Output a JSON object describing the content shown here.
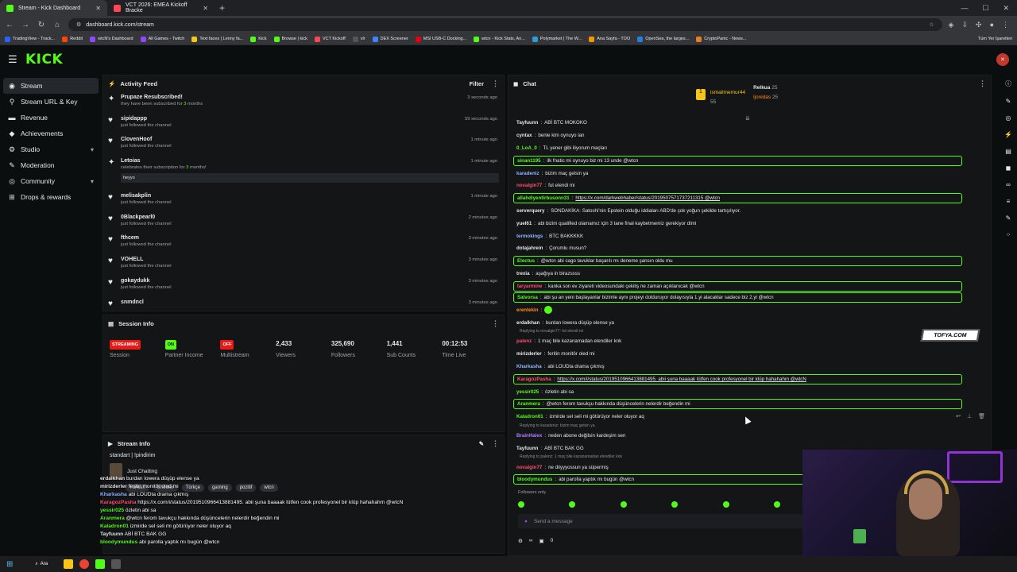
{
  "browser": {
    "tabs": [
      {
        "label": "Stream - Kick Dashboard",
        "color": "#53fc18",
        "active": true
      },
      {
        "label": "VCT 2026: EMEA Kickoff Bracke",
        "color": "#ff4655",
        "active": false
      }
    ],
    "url": "dashboard.kick.com/stream",
    "bookmarks": [
      "TradingView - Track...",
      "Reddit",
      "wtcN's Dashboard",
      "All Games - Twitch",
      "Text faces | Lenny fa...",
      "Kick",
      "Browse | kick",
      "VCT Kickoff",
      "vlr",
      "DEX Screener",
      "MSI USB-C Docking...",
      "wtcn - Kick Stats, An...",
      "Polymarket | The W...",
      "Ana Sayfa - TOO",
      "OpenSea, the larges...",
      "CryptoPanic - News..."
    ],
    "bookmarks_right": "Tüm Yer İşaretleri"
  },
  "brand": {
    "logo": "KICK",
    "accent": "#53fc18"
  },
  "sidebar": {
    "items": [
      {
        "label": "Stream",
        "icon": "broadcast-icon",
        "glyph": "◉"
      },
      {
        "label": "Stream URL & Key",
        "icon": "key-icon",
        "glyph": "⚲"
      },
      {
        "label": "Revenue",
        "icon": "cash-icon",
        "glyph": "▬"
      },
      {
        "label": "Achievements",
        "icon": "trophy-icon",
        "glyph": "◆"
      },
      {
        "label": "Studio",
        "icon": "studio-icon",
        "glyph": "⚙"
      },
      {
        "label": "Moderation",
        "icon": "wrench-icon",
        "glyph": "✎"
      },
      {
        "label": "Community",
        "icon": "community-icon",
        "glyph": "◎"
      },
      {
        "label": "Drops & rewards",
        "icon": "gift-icon",
        "glyph": "⊞"
      }
    ]
  },
  "activity": {
    "title": "Activity Feed",
    "filter": "Filter",
    "items": [
      {
        "name": "Prupaze Resubscribed!",
        "sub": "they have been subscribed for ",
        "sub_strong": "3",
        "sub_after": " months",
        "time": "3 seconds ago",
        "icon": "star-icon",
        "glyph": "✦"
      },
      {
        "name": "sipidappp",
        "sub": "just followed the channel",
        "sub_strong": "",
        "sub_after": "",
        "time": "59 seconds ago",
        "icon": "heart-icon",
        "glyph": "♥"
      },
      {
        "name": "ClovenHoof",
        "sub": "just followed the channel",
        "sub_strong": "",
        "sub_after": "",
        "time": "1 minute ago",
        "icon": "heart-icon",
        "glyph": "♥"
      },
      {
        "name": "Letoias",
        "sub": "celebrates their subscription for ",
        "sub_strong": "3",
        "sub_after": " months!",
        "time": "1 minute ago",
        "icon": "star-icon",
        "glyph": "✦",
        "message": "heyyo"
      },
      {
        "name": "melisakplin",
        "sub": "just followed the channel",
        "sub_strong": "",
        "sub_after": "",
        "time": "1 minute ago",
        "icon": "heart-icon",
        "glyph": "♥"
      },
      {
        "name": "0Blackpearl0",
        "sub": "just followed the channel",
        "sub_strong": "",
        "sub_after": "",
        "time": "2 minutes ago",
        "icon": "heart-icon",
        "glyph": "♥"
      },
      {
        "name": "fthcem",
        "sub": "just followed the channel",
        "sub_strong": "",
        "sub_after": "",
        "time": "3 minutes ago",
        "icon": "heart-icon",
        "glyph": "♥"
      },
      {
        "name": "VOHELL",
        "sub": "just followed the channel",
        "sub_strong": "",
        "sub_after": "",
        "time": "3 minutes ago",
        "icon": "heart-icon",
        "glyph": "♥"
      },
      {
        "name": "gokaydukk",
        "sub": "just followed the channel",
        "sub_strong": "",
        "sub_after": "",
        "time": "3 minutes ago",
        "icon": "heart-icon",
        "glyph": "♥"
      },
      {
        "name": "snmdncl",
        "sub": "",
        "sub_strong": "",
        "sub_after": "",
        "time": "3 minutes ago",
        "icon": "heart-icon",
        "glyph": "♥"
      }
    ]
  },
  "session": {
    "title": "Session Info",
    "stats": [
      {
        "badge": "STREAMING",
        "badge_color": "red",
        "label": "Session"
      },
      {
        "badge": "ON",
        "badge_color": "green",
        "label": "Partner Income"
      },
      {
        "badge": "OFF",
        "badge_color": "red",
        "label": "Multistream"
      },
      {
        "value": "2,433",
        "label": "Viewers"
      },
      {
        "value": "325,690",
        "label": "Followers"
      },
      {
        "value": "1,441",
        "label": "Sub Counts"
      },
      {
        "value": "00:12:53",
        "label": "Time Live"
      }
    ]
  },
  "stream_info": {
    "title": "Stream Info",
    "stream_title": "standart | !pindirim",
    "category": "Just Chatting",
    "tags": [
      "Türkish",
      "Shooter",
      "Türkçe",
      "gaming",
      "pozitif",
      "wtcn"
    ]
  },
  "overlay_chat": [
    {
      "user": "erdalkhan",
      "text": "burdan lowera düşüp elense ya",
      "color": "#e6e7e8"
    },
    {
      "user": "mirizderler",
      "text": "feritin monitör oled mi",
      "color": "#e6e7e8"
    },
    {
      "user": "Kharkasha",
      "text": "abi LOUDta drama çıkmış",
      "color": "#8fb4ff"
    },
    {
      "user": "KaragozPasha",
      "text": "https://x.com/i/status/2019510966413881495. abii şuna baaaak lütfen cook profesyonel bir klüp hahahahm @wtcN",
      "color": "#ff4d6d"
    },
    {
      "user": "yessir025",
      "text": "özletin abi sa",
      "color": "#53fc18"
    },
    {
      "user": "Aranmera",
      "text": "@wtcn ferom tavukçu hakkında düşüncelerin nelerdir beğendin mi",
      "color": "#53fc18"
    },
    {
      "user": "Kaladron01",
      "text": "izmirde sel seli mi götürüyor neler oluyor aq",
      "color": "#53fc18"
    },
    {
      "user": "Tayfuunn",
      "text": "ABİ BTC BAK GG",
      "color": "#e6e7e8"
    },
    {
      "user": "bloodymundus",
      "text": "abi parolla yaptık mı bugün @wtcn",
      "color": "#53fc18"
    }
  ],
  "chat": {
    "title": "Chat",
    "pinned_left": [
      {
        "name": "ismailmemur44",
        "value": "55"
      }
    ],
    "pinned_right": [
      {
        "name": "Relkua",
        "value": "25"
      },
      {
        "name": "ljonidas",
        "value": "25"
      }
    ],
    "messages": [
      {
        "user": "Tayfuunn",
        "text": "ABİ BTC MOKOKO",
        "color": "#e6e7e8",
        "hl": false
      },
      {
        "user": "cyntax",
        "text": "benle kim oynuyo lan",
        "color": "#e6e7e8",
        "hl": false
      },
      {
        "user": "0_LoA_0",
        "text": "TL yener gibi iliyorum maçları",
        "color": "#53fc18",
        "hl": false
      },
      {
        "user": "sinan1195",
        "text": "ilk fnatic mi oynuyo biz mi 13 unde @wtcn",
        "color": "#53fc18",
        "hl": true
      },
      {
        "user": "karadeniz",
        "text": "bizim maç gelsin ya",
        "color": "#8fb4ff",
        "hl": false
      },
      {
        "user": "novalgin77",
        "text": "fut elendi mi",
        "color": "#ff4d6d",
        "hl": false
      },
      {
        "user": "allahdiyentirbusonn31",
        "text": "https://x.com/darkwebhaber/status/2019507571737211315 @wtcn",
        "color": "#53fc18",
        "hl": true
      },
      {
        "user": "serverquery",
        "text": "SONDAKİKA: Satoshi'nin Epstein olduğu iddiaları ABD'de çok yoğun şekilde tartışılıyor.",
        "color": "#e6e7e8",
        "hl": false
      },
      {
        "user": "yuel61",
        "text": "abi bizim qualified olamamız için 3 tane final kaybetmemiz gerekiyor dimi",
        "color": "#e6e7e8",
        "hl": false
      },
      {
        "user": "termokings",
        "text": "BTC BAKKKKK",
        "color": "#8fb4ff",
        "hl": false
      },
      {
        "user": "dotajahrein",
        "text": "Çorumlu musun?",
        "color": "#e6e7e8",
        "hl": false
      },
      {
        "user": "Electus",
        "text": "@wtcn abi cago tavuklar başarılı mı deneme şansın oldu mu",
        "color": "#53fc18",
        "hl": true
      },
      {
        "user": "trexia",
        "text": "aşağıya in birazssss",
        "color": "#e6e7e8",
        "hl": false
      },
      {
        "user": "laryarmine",
        "text": "kanka son ev ziyareti videosundaki çekiliş ne zaman açıklanıcak @wtcn",
        "color": "#ff4d6d",
        "hl": true
      },
      {
        "user": "Salvorsa",
        "text": "abi şu an yeni başlayanlar bizimle aynı projeyi dolduruyor dolayısıyla 1.yi alacaklar sadece biz 2.yi @wtcn",
        "color": "#53fc18",
        "hl": true
      },
      {
        "user": "erentekin",
        "text": "",
        "color": "#ff8c1a",
        "hl": false
      },
      {
        "user": "erdalkhan",
        "text": "burdan lowera düşüp elense ya",
        "color": "#e6e7e8",
        "hl": false
      },
      {
        "user": "palenz",
        "text": "1 maç bile kazanamadan elendiler knk",
        "color": "#ff4d6d",
        "hl": false,
        "reply": "Replying to novalgin77: fut elendi mi"
      },
      {
        "user": "mirizderler",
        "text": "feritin monitör oled mi",
        "color": "#e6e7e8",
        "hl": false
      },
      {
        "user": "Kharkasha",
        "text": "abi LOUDta drama çıkmış",
        "color": "#8fb4ff",
        "hl": false
      },
      {
        "user": "KaragozPasha",
        "text": "https://x.com/i/status/2019510966413881495. abii şuna baaaak lütfen cook profesyonel bir klüp hahahahm @wtcN",
        "color": "#ff4d6d",
        "hl": true
      },
      {
        "user": "yessir025",
        "text": "özletin abi sa",
        "color": "#53fc18",
        "hl": false
      },
      {
        "user": "Aranmera",
        "text": "@wtcn ferom tavukçu hakkında düşüncelerin nelerdir beğendin mi",
        "color": "#53fc18",
        "hl": true
      },
      {
        "user": "Kaladron01",
        "text": "izmirde sel seli mi götürüyor neler oluyor aq",
        "color": "#53fc18",
        "hl": false
      },
      {
        "user": "BrainHalex",
        "text": "neden abone değilsin kardeşim sen",
        "color": "#b07cff",
        "hl": false,
        "reply": "Replying to karadeniz: bizim maç gelsin ya"
      },
      {
        "user": "Tayfuunn",
        "text": "ABİ BTC BAK GG",
        "color": "#e6e7e8",
        "hl": false
      },
      {
        "user": "novalgin77",
        "text": "ne diiyyyossun ya süpermiş",
        "color": "#ff4d6d",
        "hl": false,
        "reply": "Replying to palenz: 1 maç bile kazanamadan elendiler knk"
      },
      {
        "user": "bloodymundus",
        "text": "abi parolla yaptık mı bugün @wtcn",
        "color": "#53fc18",
        "hl": true
      }
    ],
    "followers_only": "Followers only",
    "input_placeholder": "Send a message",
    "bottom_count": "0"
  },
  "watermark": "TOFYA.COM",
  "taskbar": {
    "search": "Ara"
  }
}
